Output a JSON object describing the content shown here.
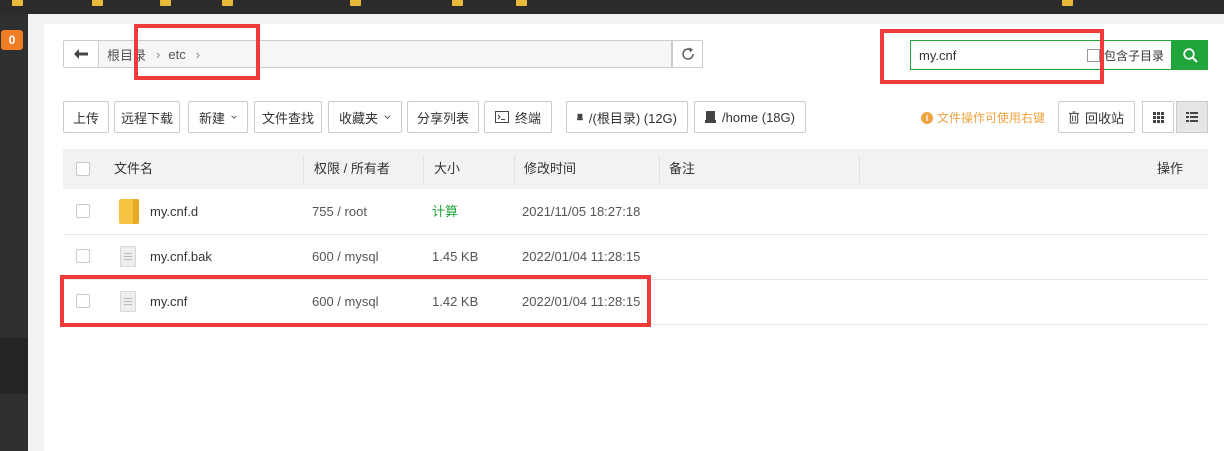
{
  "toolbar": {
    "upload": "上传",
    "remote_download": "远程下载",
    "new": "新建",
    "file_search": "文件查找",
    "favorites": "收藏夹",
    "share_list": "分享列表",
    "terminal": "终端",
    "disk_root": "/(根目录) (12G)",
    "disk_home": "/home (18G)",
    "tip": "文件操作可使用右键",
    "recycle_bin": "回收站"
  },
  "left_badge": "0",
  "breadcrumb": {
    "items": [
      "根目录",
      "etc"
    ]
  },
  "search": {
    "value": "my.cnf",
    "include_subdir": "包含子目录"
  },
  "table": {
    "headers": {
      "name": "文件名",
      "permission": "权限 / 所有者",
      "size": "大小",
      "modified": "修改时间",
      "remark": "备注",
      "actions": "操作"
    },
    "rows": [
      {
        "name": "my.cnf.d",
        "type": "folder",
        "permission": "755 / root",
        "size": "计算",
        "modified": "2021/11/05 18:27:18"
      },
      {
        "name": "my.cnf.bak",
        "type": "file",
        "permission": "600 / mysql",
        "size": "1.45 KB",
        "modified": "2022/01/04 11:28:15"
      },
      {
        "name": "my.cnf",
        "type": "file",
        "permission": "600 / mysql",
        "size": "1.42 KB",
        "modified": "2022/01/04 11:28:15"
      }
    ]
  },
  "colors": {
    "accent_green": "#20a53a",
    "annotation_red": "#f03a3a",
    "tip_orange": "#f0a341",
    "badge_orange": "#f07d26"
  }
}
